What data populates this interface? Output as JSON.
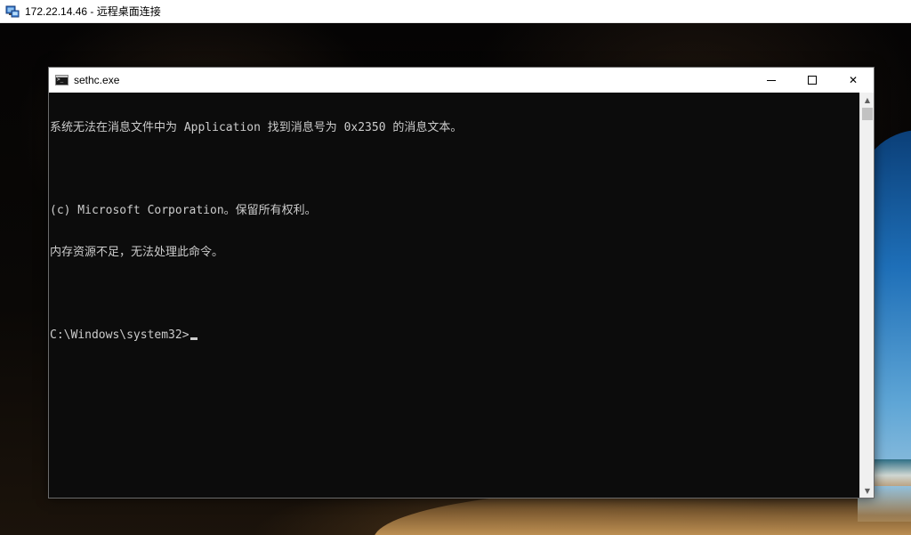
{
  "rdp": {
    "title": "172.22.14.46 - 远程桌面连接",
    "icon": "remote-desktop-icon"
  },
  "console": {
    "title": "sethc.exe",
    "icon": "cmd-icon",
    "controls": {
      "minimize": "minimize-icon",
      "maximize": "maximize-icon",
      "close_glyph": "✕"
    },
    "lines": [
      "系统无法在消息文件中为 Application 找到消息号为 0x2350 的消息文本。",
      "",
      "(c) Microsoft Corporation。保留所有权利。",
      "内存资源不足，无法处理此命令。",
      "",
      "C:\\Windows\\system32>"
    ]
  },
  "scrollbar": {
    "up_glyph": "▲",
    "down_glyph": "▼"
  },
  "colors": {
    "console_bg": "#0c0c0c",
    "console_text": "#cccccc",
    "titlebar_bg": "#ffffff",
    "scrollbar_bg": "#f0f0f0"
  }
}
